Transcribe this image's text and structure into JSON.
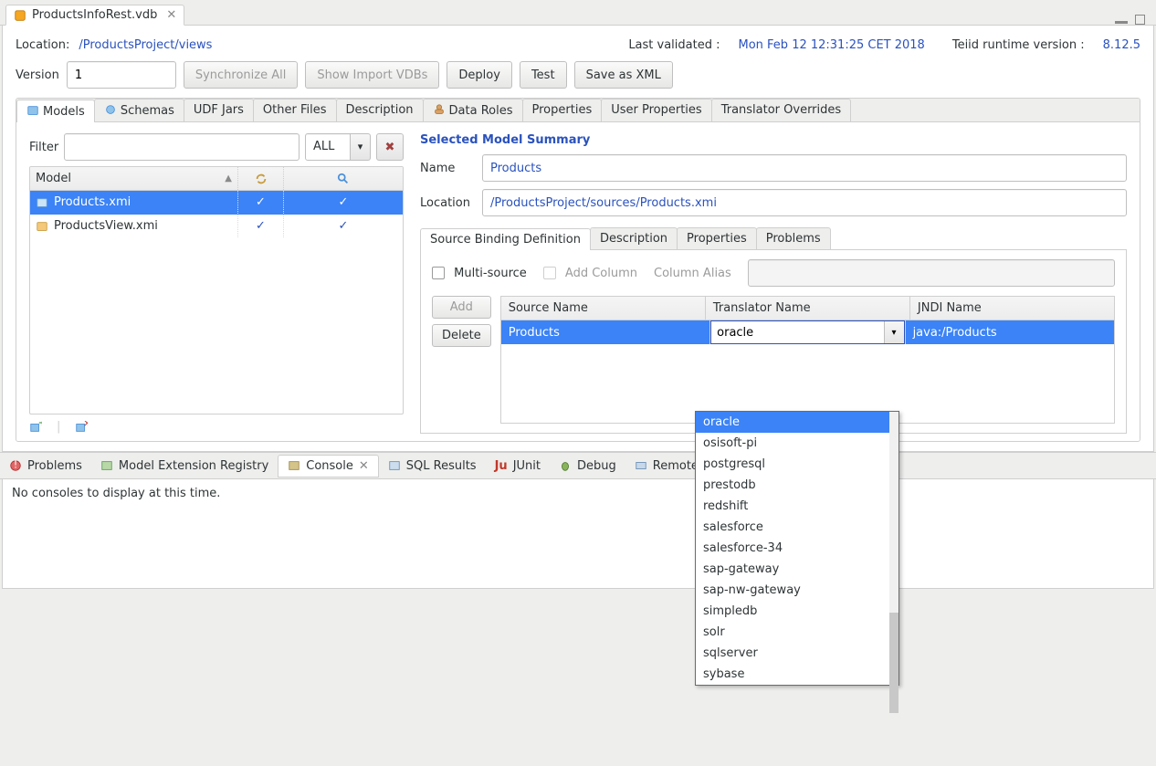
{
  "docTab": {
    "title": "ProductsInfoRest.vdb"
  },
  "header": {
    "locationLabel": "Location:",
    "locationValue": "/ProductsProject/views",
    "lastValidatedLabel": "Last validated :",
    "lastValidatedValue": "Mon Feb 12 12:31:25 CET 2018",
    "runtimeLabel": "Teiid runtime version :",
    "runtimeValue": "8.12.5"
  },
  "versionRow": {
    "label": "Version",
    "value": "1",
    "syncAll": "Synchronize All",
    "showImport": "Show Import VDBs",
    "deploy": "Deploy",
    "test": "Test",
    "saveXml": "Save as XML"
  },
  "mainTabs": [
    "Models",
    "Schemas",
    "UDF Jars",
    "Other Files",
    "Description",
    "Data Roles",
    "Properties",
    "User Properties",
    "Translator Overrides"
  ],
  "filter": {
    "label": "Filter",
    "all": "ALL"
  },
  "modelTable": {
    "header": "Model",
    "rows": [
      {
        "name": "Products.xmi",
        "c1": "✓",
        "c2": "✓",
        "selected": true
      },
      {
        "name": "ProductsView.xmi",
        "c1": "✓",
        "c2": "✓",
        "selected": false
      }
    ]
  },
  "summary": {
    "title": "Selected Model Summary",
    "nameLabel": "Name",
    "nameValue": "Products",
    "locLabel": "Location",
    "locValue": "/ProductsProject/sources/Products.xmi"
  },
  "subTabs": [
    "Source Binding Definition",
    "Description",
    "Properties",
    "Problems"
  ],
  "options": {
    "multiSource": "Multi-source",
    "addColumn": "Add Column",
    "columnAlias": "Column Alias"
  },
  "srcButtons": {
    "add": "Add",
    "delete": "Delete"
  },
  "srcTable": {
    "headers": {
      "src": "Source Name",
      "tr": "Translator Name",
      "jn": "JNDI Name"
    },
    "row": {
      "src": "Products",
      "tr": "oracle",
      "jn": "java:/Products"
    }
  },
  "dropdown": [
    "oracle",
    "osisoft-pi",
    "postgresql",
    "prestodb",
    "redshift",
    "salesforce",
    "salesforce-34",
    "sap-gateway",
    "sap-nw-gateway",
    "simpledb",
    "solr",
    "sqlserver",
    "sybase"
  ],
  "bottomViews": [
    "Problems",
    "Model Extension Registry",
    "Console",
    "SQL Results",
    "JUnit",
    "Debug",
    "Remote Systems"
  ],
  "console": {
    "empty": "No consoles to display at this time."
  }
}
